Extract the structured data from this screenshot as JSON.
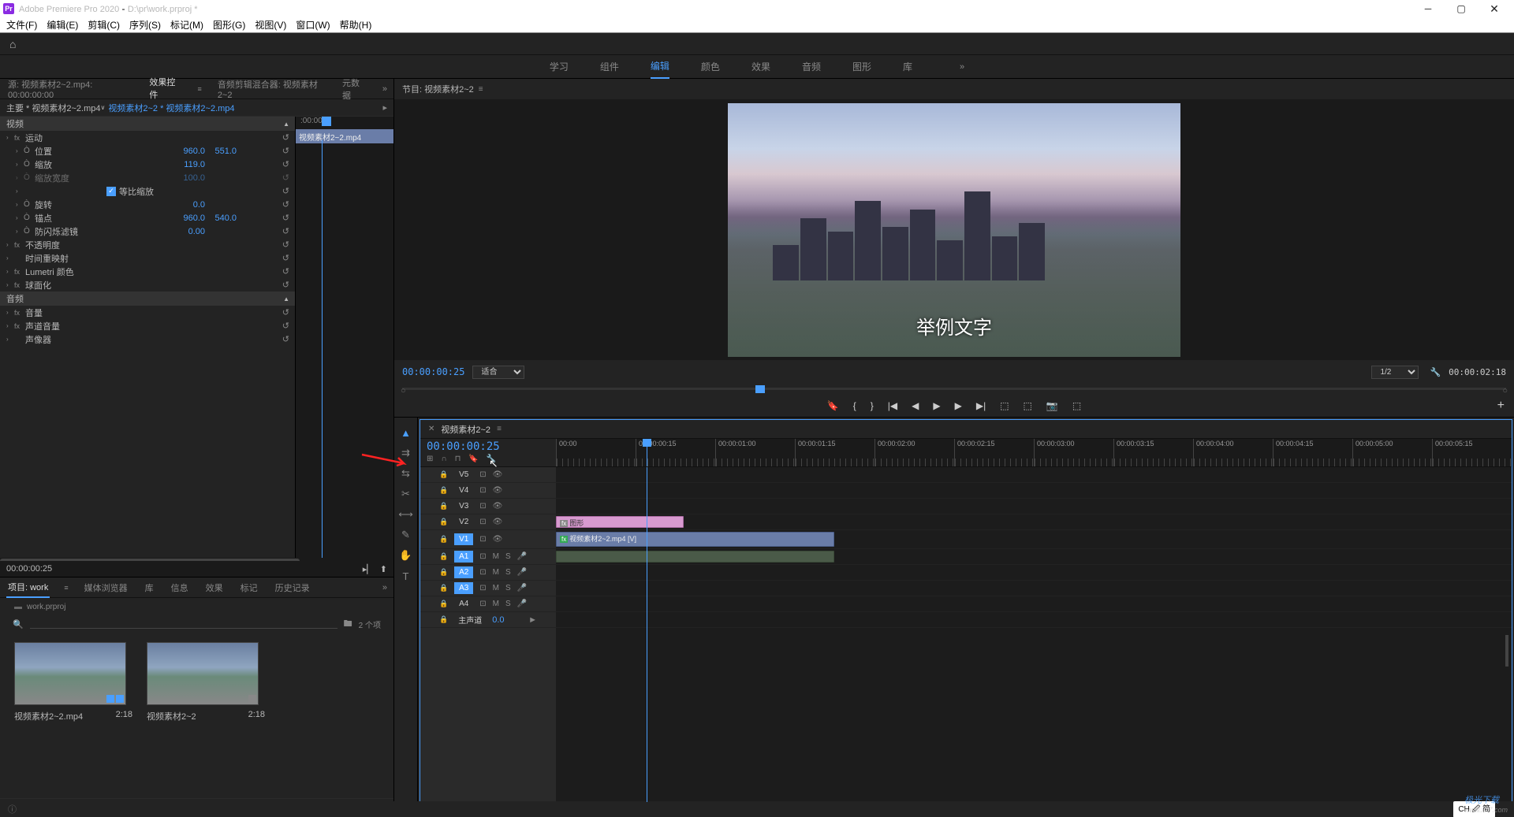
{
  "titlebar": {
    "app": "Adobe Premiere Pro 2020",
    "project_path": "D:\\pr\\work.prproj *",
    "icon_text": "Pr"
  },
  "menubar": [
    "文件(F)",
    "编辑(E)",
    "剪辑(C)",
    "序列(S)",
    "标记(M)",
    "图形(G)",
    "视图(V)",
    "窗口(W)",
    "帮助(H)"
  ],
  "workspace_tabs": {
    "items": [
      "学习",
      "组件",
      "编辑",
      "颜色",
      "效果",
      "音频",
      "图形",
      "库"
    ],
    "active_index": 2,
    "more": "»"
  },
  "source_tabs": {
    "items": [
      {
        "label": "源: 视频素材2~2.mp4: 00:00:00:00",
        "active": false
      },
      {
        "label": "效果控件",
        "active": true
      },
      {
        "label": "音频剪辑混合器: 视频素材2~2",
        "active": false
      },
      {
        "label": "元数据",
        "active": false
      }
    ],
    "arrow": "»"
  },
  "effect_controls": {
    "master_label": "主要 * 视频素材2~2.mp4",
    "clip_label": "视频素材2~2 * 视频素材2~2.mp4",
    "timeline_start": ":00:00",
    "clip_name": "视频素材2~2.mp4",
    "sections": {
      "video": "视频",
      "audio": "音频"
    },
    "effects": [
      {
        "name": "运动",
        "type": "fx",
        "rows": [
          {
            "label": "位置",
            "v1": "960.0",
            "v2": "551.0",
            "sw": true
          },
          {
            "label": "缩放",
            "v1": "119.0",
            "sw": true
          },
          {
            "label": "缩放宽度",
            "v1": "100.0",
            "sw": true,
            "dim": true
          },
          {
            "label": "等比缩放",
            "checkbox": true,
            "checked": true
          },
          {
            "label": "旋转",
            "v1": "0.0",
            "sw": true
          },
          {
            "label": "锚点",
            "v1": "960.0",
            "v2": "540.0",
            "sw": true
          },
          {
            "label": "防闪烁滤镜",
            "v1": "0.00",
            "sw": true
          }
        ]
      },
      {
        "name": "不透明度",
        "type": "fx"
      },
      {
        "name": "时间重映射",
        "type": "plain"
      },
      {
        "name": "Lumetri 颜色",
        "type": "fx"
      },
      {
        "name": "球面化",
        "type": "fx"
      }
    ],
    "audio_effects": [
      {
        "name": "音量",
        "type": "fx"
      },
      {
        "name": "声道音量",
        "type": "fx"
      },
      {
        "name": "声像器",
        "type": "plain"
      }
    ],
    "current_time": "00:00:00:25"
  },
  "project_tabs": {
    "items": [
      {
        "label": "项目: work",
        "active": true
      },
      {
        "label": "媒体浏览器",
        "active": false
      },
      {
        "label": "库",
        "active": false
      },
      {
        "label": "信息",
        "active": false
      },
      {
        "label": "效果",
        "active": false
      },
      {
        "label": "标记",
        "active": false
      },
      {
        "label": "历史记录",
        "active": false
      }
    ],
    "arrow": "»"
  },
  "project": {
    "filename": "work.prproj",
    "count": "2 个项",
    "items": [
      {
        "name": "视频素材2~2.mp4",
        "duration": "2:18"
      },
      {
        "name": "视频素材2~2",
        "duration": "2:18"
      }
    ]
  },
  "program": {
    "title": "节目: 视频素材2~2",
    "overlay_text": "举例文字",
    "timecode": "00:00:00:25",
    "fit": "适合",
    "scale": "1/2",
    "duration": "00:00:02:18"
  },
  "timeline": {
    "sequence_name": "视频素材2~2",
    "timecode": "00:00:00:25",
    "ruler": [
      "00:00",
      "00:00:00:15",
      "00:00:01:00",
      "00:00:01:15",
      "00:00:02:00",
      "00:00:02:15",
      "00:00:03:00",
      "00:00:03:15",
      "00:00:04:00",
      "00:00:04:15",
      "00:00:05:00",
      "00:00:05:15"
    ],
    "video_tracks": [
      "V5",
      "V4",
      "V3",
      "V2",
      "V1"
    ],
    "audio_tracks": [
      "A1",
      "A2",
      "A3",
      "A4"
    ],
    "master": "主声道",
    "master_val": "0.0",
    "graphic_clip": "图形",
    "video_clip": "视频素材2~2.mp4 [V]"
  },
  "ime": "CH 🖉 简"
}
